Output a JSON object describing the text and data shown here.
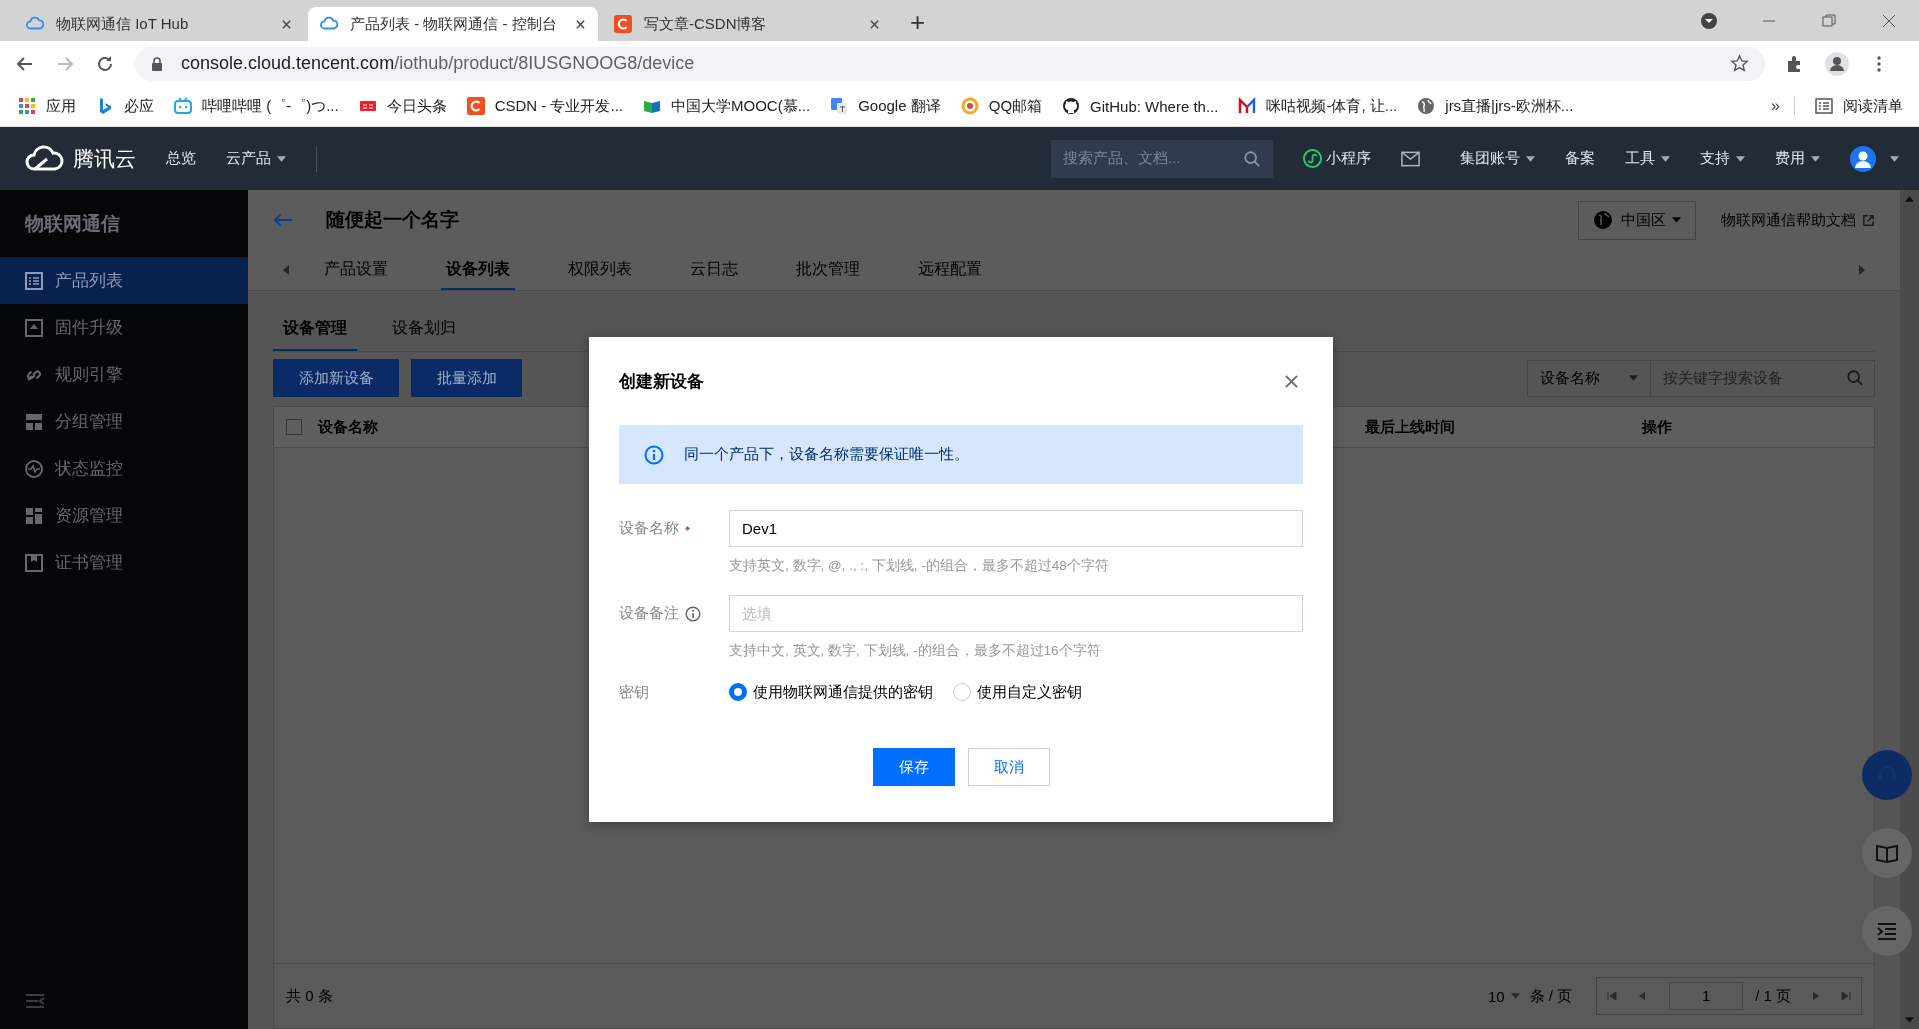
{
  "browser": {
    "tabs": [
      {
        "title": "物联网通信 IoT Hub",
        "kind": "cloud",
        "selected": false
      },
      {
        "title": "产品列表 - 物联网通信 - 控制台",
        "kind": "cloud",
        "selected": true
      },
      {
        "title": "写文章-CSDN博客",
        "kind": "csdn",
        "selected": false
      }
    ],
    "new_tab": "+",
    "url": {
      "host": "console.cloud.tencent.com",
      "path": "/iothub/product/8IUSGNOOG8/device"
    },
    "bookmarks": [
      {
        "label": "应用",
        "kind": "apps"
      },
      {
        "label": "必应",
        "kind": "bing"
      },
      {
        "label": "哔哩哔哩 (゜-゜)つ...",
        "kind": "tv"
      },
      {
        "label": "今日头条",
        "kind": "news"
      },
      {
        "label": "CSDN - 专业开发...",
        "kind": "csdn"
      },
      {
        "label": "中国大学MOOC(慕...",
        "kind": "book"
      },
      {
        "label": "Google 翻译",
        "kind": "translate"
      },
      {
        "label": "QQ邮箱",
        "kind": "qq"
      },
      {
        "label": "GitHub: Where th...",
        "kind": "cat"
      },
      {
        "label": "咪咕视频-体育, 让...",
        "kind": "m"
      },
      {
        "label": "jrs直播|jrs-欧洲杯...",
        "kind": "globe"
      }
    ],
    "bookmarks_more": "»",
    "reading_list": "阅读清单"
  },
  "nav": {
    "logo": "腾讯云",
    "items": [
      {
        "label": "总览",
        "dropdown": false
      },
      {
        "label": "云产品",
        "dropdown": true
      }
    ],
    "search_placeholder": "搜索产品、文档...",
    "right_items": [
      {
        "kind": "miniapp",
        "label": "小程序"
      },
      {
        "kind": "mail"
      },
      {
        "kind": "text",
        "label": "集团账号",
        "dropdown": true
      },
      {
        "kind": "text",
        "label": "备案",
        "dropdown": false
      },
      {
        "kind": "text",
        "label": "工具",
        "dropdown": true
      },
      {
        "kind": "text",
        "label": "支持",
        "dropdown": true
      },
      {
        "kind": "text",
        "label": "费用",
        "dropdown": true
      },
      {
        "kind": "avatar",
        "dropdown": true
      }
    ]
  },
  "sidebar": {
    "title": "物联网通信",
    "items": [
      {
        "label": "产品列表",
        "kind": "list",
        "selected": true
      },
      {
        "label": "固件升级",
        "kind": "upload",
        "selected": false
      },
      {
        "label": "规则引擎",
        "kind": "link",
        "selected": false
      },
      {
        "label": "分组管理",
        "kind": "group",
        "selected": false
      },
      {
        "label": "状态监控",
        "kind": "monitor",
        "selected": false
      },
      {
        "label": "资源管理",
        "kind": "grid",
        "selected": false
      },
      {
        "label": "证书管理",
        "kind": "cert",
        "selected": false
      }
    ]
  },
  "page": {
    "title": "随便起一个名字",
    "region": "中国区",
    "help_link": "物联网通信帮助文档",
    "tabs": [
      {
        "label": "产品设置",
        "selected": false
      },
      {
        "label": "设备列表",
        "selected": true
      },
      {
        "label": "权限列表",
        "selected": false
      },
      {
        "label": "云日志",
        "selected": false
      },
      {
        "label": "批次管理",
        "selected": false
      },
      {
        "label": "远程配置",
        "selected": false
      }
    ],
    "subtabs": [
      {
        "label": "设备管理",
        "selected": true
      },
      {
        "label": "设备划归",
        "selected": false
      }
    ],
    "actions": [
      {
        "label": "添加新设备"
      },
      {
        "label": "批量添加"
      }
    ],
    "filter": {
      "field": "设备名称",
      "placeholder": "按关键字搜索设备"
    },
    "table": {
      "select_all_checked": false,
      "columns": [
        "设备名称",
        "最后上线时间",
        "操作"
      ],
      "total": "共 0 条",
      "page_size": "10",
      "page_size_unit": "条 / 页",
      "page": "1",
      "page_total": "/ 1 页"
    }
  },
  "modal": {
    "title": "创建新设备",
    "notice": "同一个产品下，设备名称需要保证唯一性。",
    "fields": [
      {
        "kind": "text",
        "label": "设备名称",
        "required": true,
        "info": false,
        "value": "Dev1",
        "hint": "支持英文, 数字, @, ., :, 下划线, -的组合，最多不超过48个字符"
      },
      {
        "kind": "text",
        "label": "设备备注",
        "required": false,
        "info": true,
        "placeholder": "选填",
        "hint": "支持中文, 英文, 数字, 下划线, -的组合，最多不超过16个字符"
      },
      {
        "kind": "radio",
        "label": "密钥",
        "options": [
          {
            "label": "使用物联网通信提供的密钥",
            "selected": true
          },
          {
            "label": "使用自定义密钥",
            "selected": false
          }
        ]
      }
    ],
    "buttons": [
      {
        "label": "保存",
        "kind": "primary"
      },
      {
        "label": "取消",
        "kind": "secondary"
      }
    ]
  }
}
